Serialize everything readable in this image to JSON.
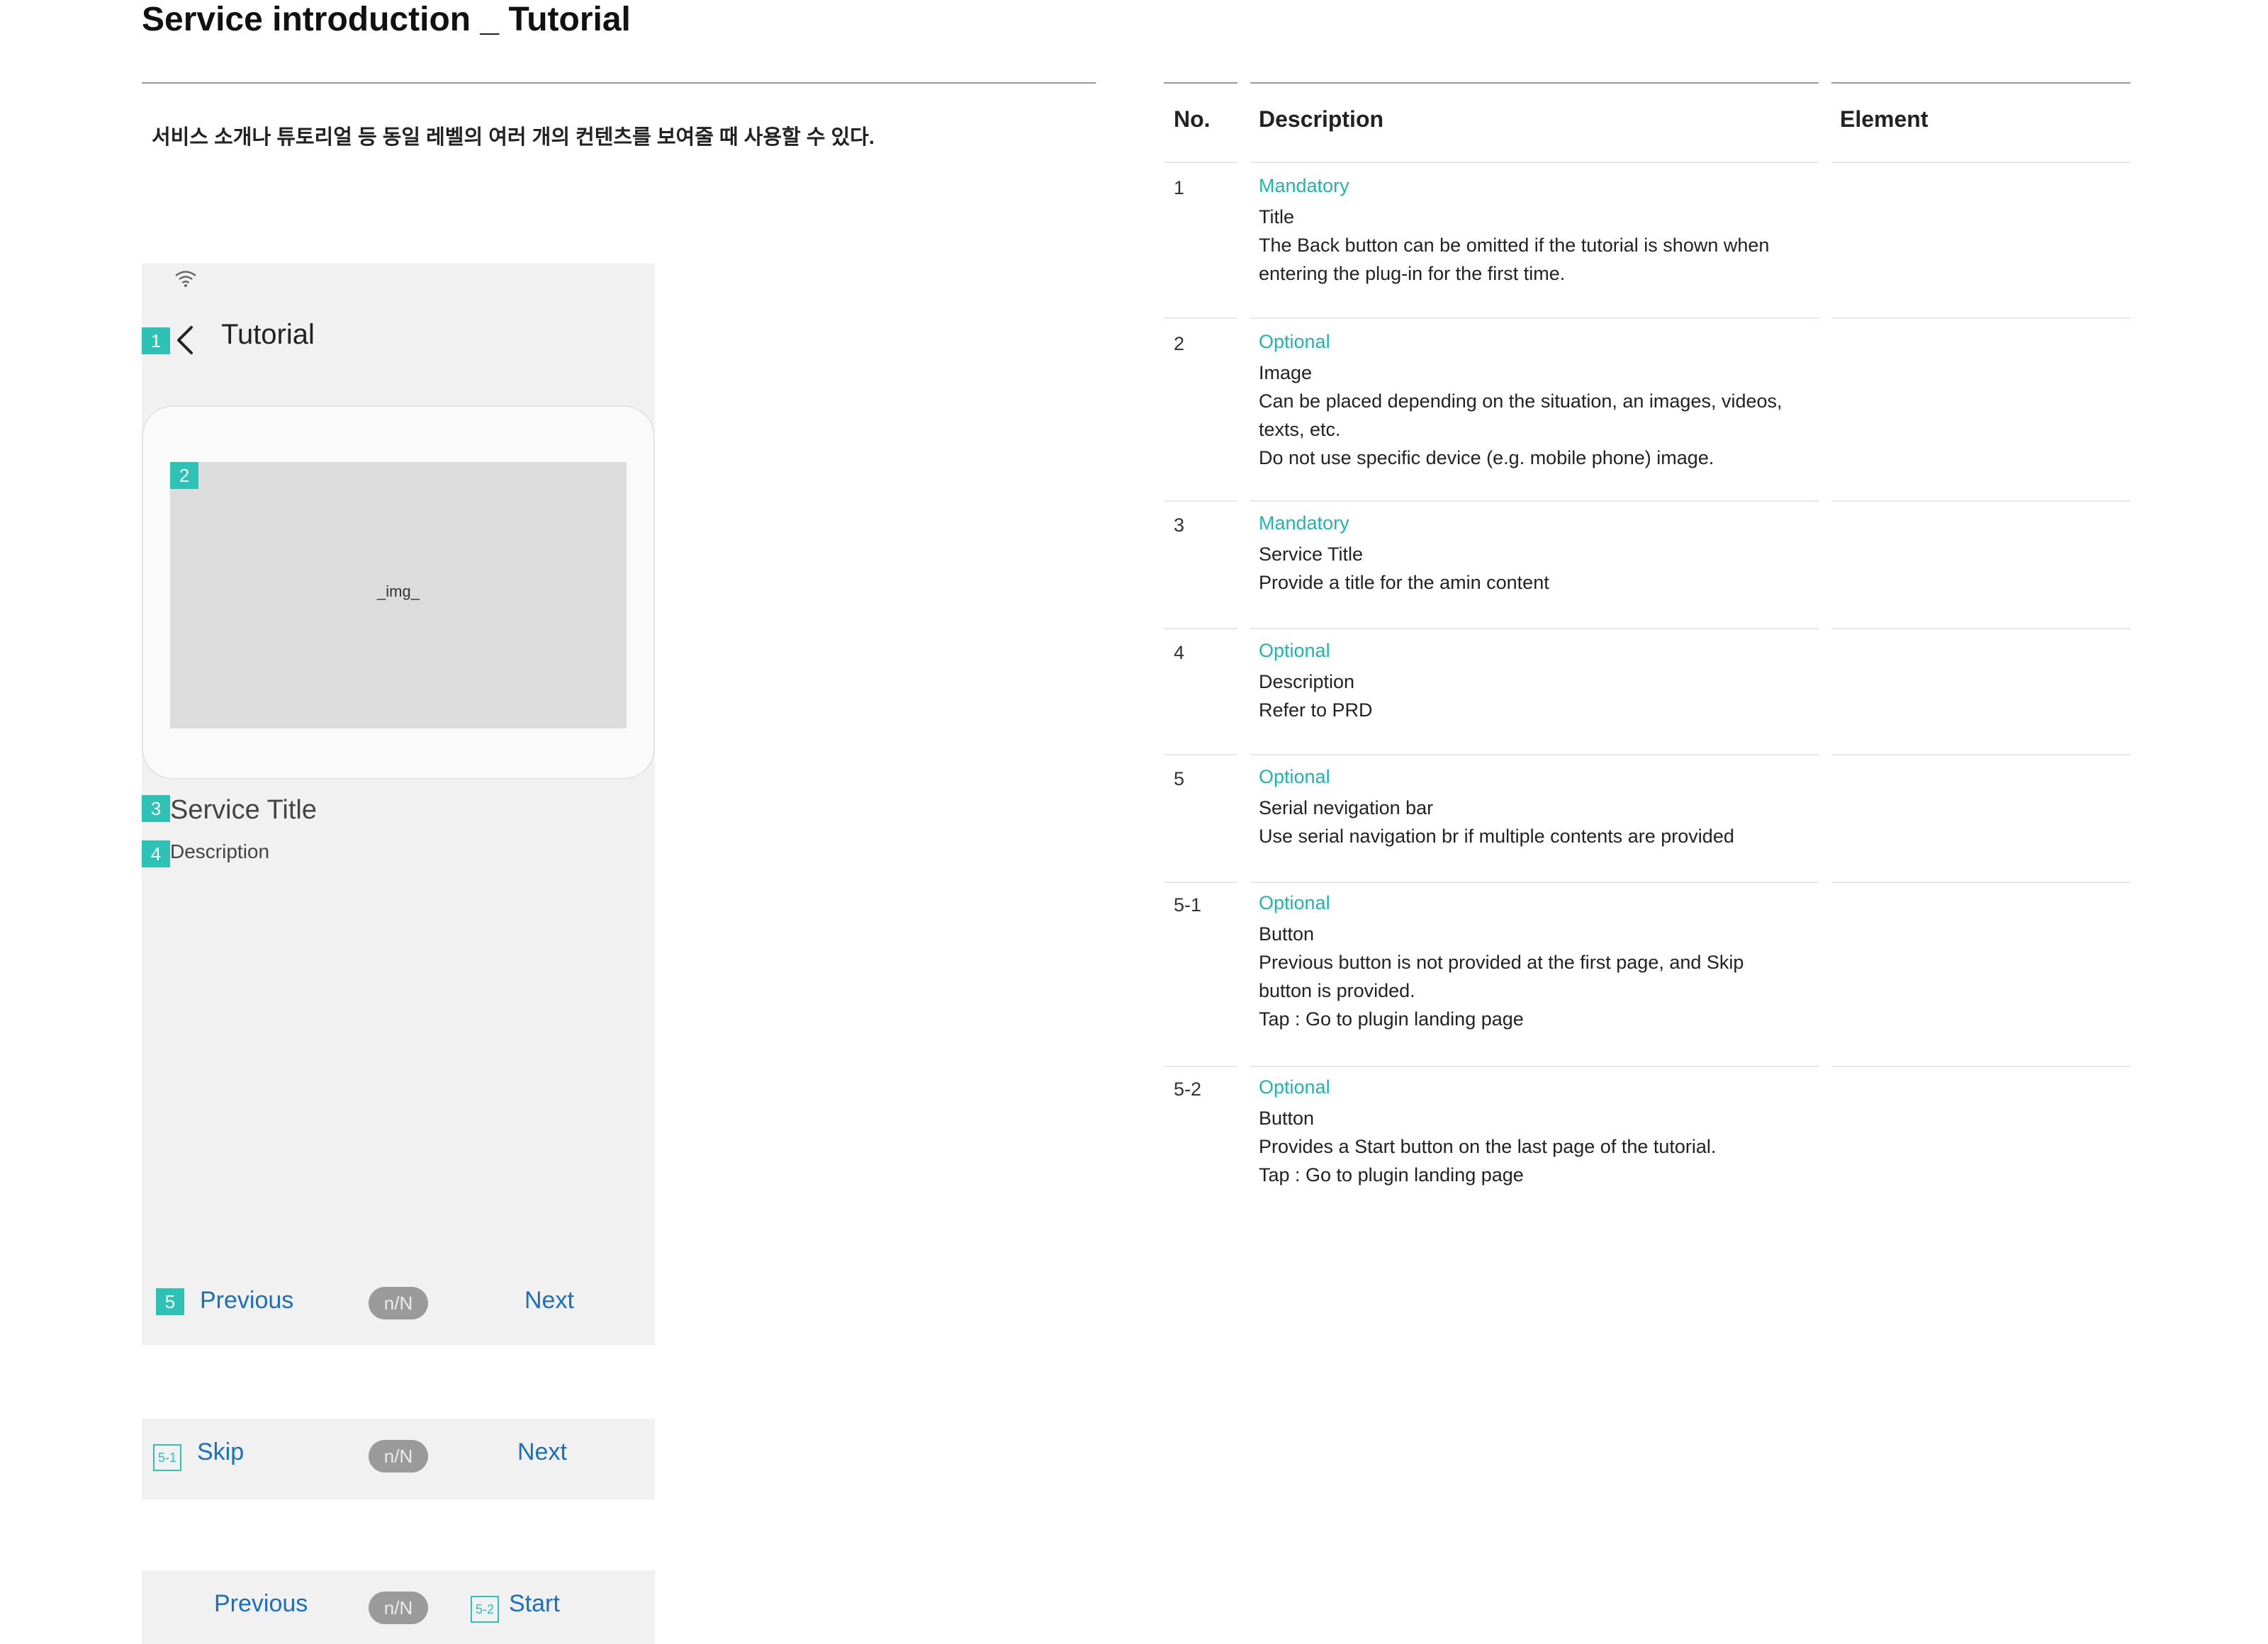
{
  "page": {
    "title": "Service introduction _ Tutorial",
    "intro": "서비스 소개나 튜토리얼 등 동일 레벨의 여러 개의 컨텐츠를 보여줄 때 사용할 수 있다."
  },
  "phone": {
    "header_title": "Tutorial",
    "image_placeholder": "_img_",
    "service_title": "Service Title",
    "description": "Description",
    "markers": {
      "m1": "1",
      "m2": "2",
      "m3": "3",
      "m4": "4",
      "m5": "5",
      "m51": "5-1",
      "m52": "5-2"
    },
    "nav1": {
      "left": "Previous",
      "pill": "n/N",
      "right": "Next"
    },
    "nav2": {
      "left": "Skip",
      "pill": "n/N",
      "right": "Next"
    },
    "nav3": {
      "left": "Previous",
      "pill": "n/N",
      "right": "Start"
    }
  },
  "table": {
    "headers": {
      "no": "No.",
      "description": "Description",
      "element": "Element"
    },
    "rows": [
      {
        "no": "1",
        "tag": "Mandatory",
        "lines": [
          "Title",
          "The Back button can be omitted if the tutorial is shown when",
          "entering the plug-in for the first time."
        ]
      },
      {
        "no": "2",
        "tag": "Optional",
        "lines": [
          "Image",
          "Can be placed depending on the situation, an images, videos,",
          "texts, etc.",
          "Do not use specific device (e.g. mobile phone) image."
        ]
      },
      {
        "no": "3",
        "tag": "Mandatory",
        "lines": [
          "Service Title",
          "Provide a title for the amin content"
        ]
      },
      {
        "no": "4",
        "tag": "Optional",
        "lines": [
          "Description",
          "Refer to PRD"
        ]
      },
      {
        "no": "5",
        "tag": "Optional",
        "lines": [
          "Serial nevigation bar",
          "Use serial navigation br if multiple contents are provided"
        ]
      },
      {
        "no": "5-1",
        "tag": "Optional",
        "lines": [
          "Button",
          "Previous button is not provided at the first page, and Skip",
          "button is provided.",
          "Tap : Go to plugin landing page"
        ]
      },
      {
        "no": "5-2",
        "tag": "Optional",
        "lines": [
          "Button",
          "Provides a Start button on the last page of the tutorial.",
          "Tap : Go to plugin landing page"
        ]
      }
    ]
  },
  "colors": {
    "accent": "#2ec1b5",
    "link": "#1a6fc0",
    "tag": "#1fb5ad"
  }
}
